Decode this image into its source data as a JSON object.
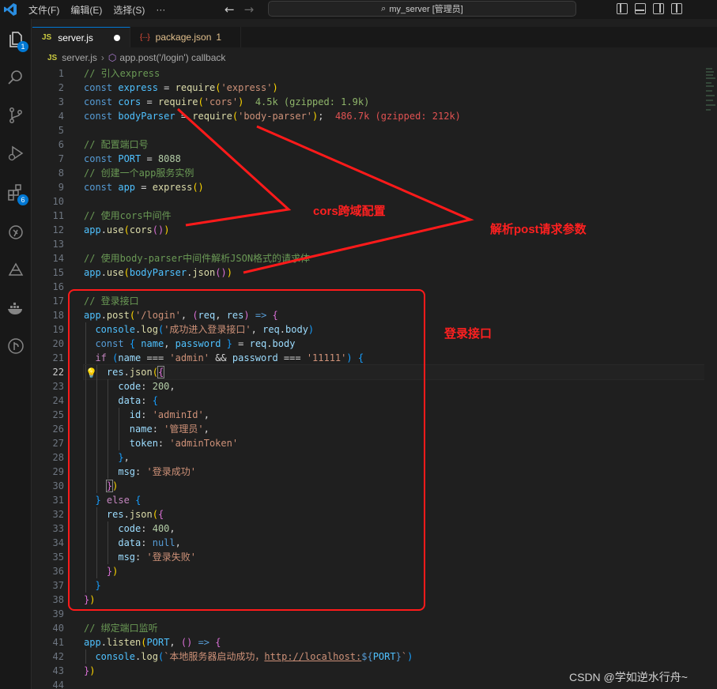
{
  "titlebar": {
    "menus": [
      "文件(F)",
      "编辑(E)",
      "选择(S)",
      "···"
    ],
    "search": "my_server [管理员]"
  },
  "activity": {
    "explorer_badge": "1",
    "extensions_badge": "6"
  },
  "tabs": [
    {
      "badge": "JS",
      "label": "server.js"
    },
    {
      "badge": "{···}",
      "label": "package.json",
      "count": "1"
    }
  ],
  "breadcrumb": {
    "badge": "JS",
    "file": "server.js",
    "symbol": "app.post('/login') callback"
  },
  "line_numbers": [
    "1",
    "2",
    "3",
    "4",
    "5",
    "6",
    "7",
    "8",
    "9",
    "10",
    "11",
    "12",
    "13",
    "14",
    "15",
    "16",
    "17",
    "18",
    "19",
    "20",
    "21",
    "22",
    "23",
    "24",
    "25",
    "26",
    "27",
    "28",
    "29",
    "30",
    "31",
    "32",
    "33",
    "34",
    "35",
    "36",
    "37",
    "38",
    "39",
    "40",
    "41",
    "42",
    "43",
    "44"
  ],
  "code": {
    "l1": "// 引入express",
    "l3_hint": "4.5k (gzipped: 1.9k)",
    "l4_hint": "486.7k (gzipped: 212k)",
    "l6": "// 配置端口号",
    "l8": "// 创建一个app服务实例",
    "l11": "// 使用cors中间件",
    "l14": "// 使用body-parser中间件解析JSON格式的请求体",
    "l17": "// 登录接口",
    "l19_str": "'成功进入登录接口'",
    "l21_str": "'admin'",
    "l21_str2": "'11111'",
    "l26_str": "'adminId'",
    "l27_str": "'管理员'",
    "l28_str": "'adminToken'",
    "l30_str": "'登录成功'",
    "l36_str": "'登录失败'",
    "l40": "// 绑定端口监听",
    "l42_str": "`本地服务器启动成功，",
    "l42_url": "http://localhost:",
    "port_num": "8088",
    "code_200": "200",
    "code_400": "400"
  },
  "annotations": {
    "cors": "cors跨域配置",
    "parse": "解析post请求参数",
    "login": "登录接口"
  },
  "watermark": "CSDN @学如逆水行舟~",
  "colors": {
    "annotation": "#ff1a1a",
    "accent": "#0078d4"
  }
}
